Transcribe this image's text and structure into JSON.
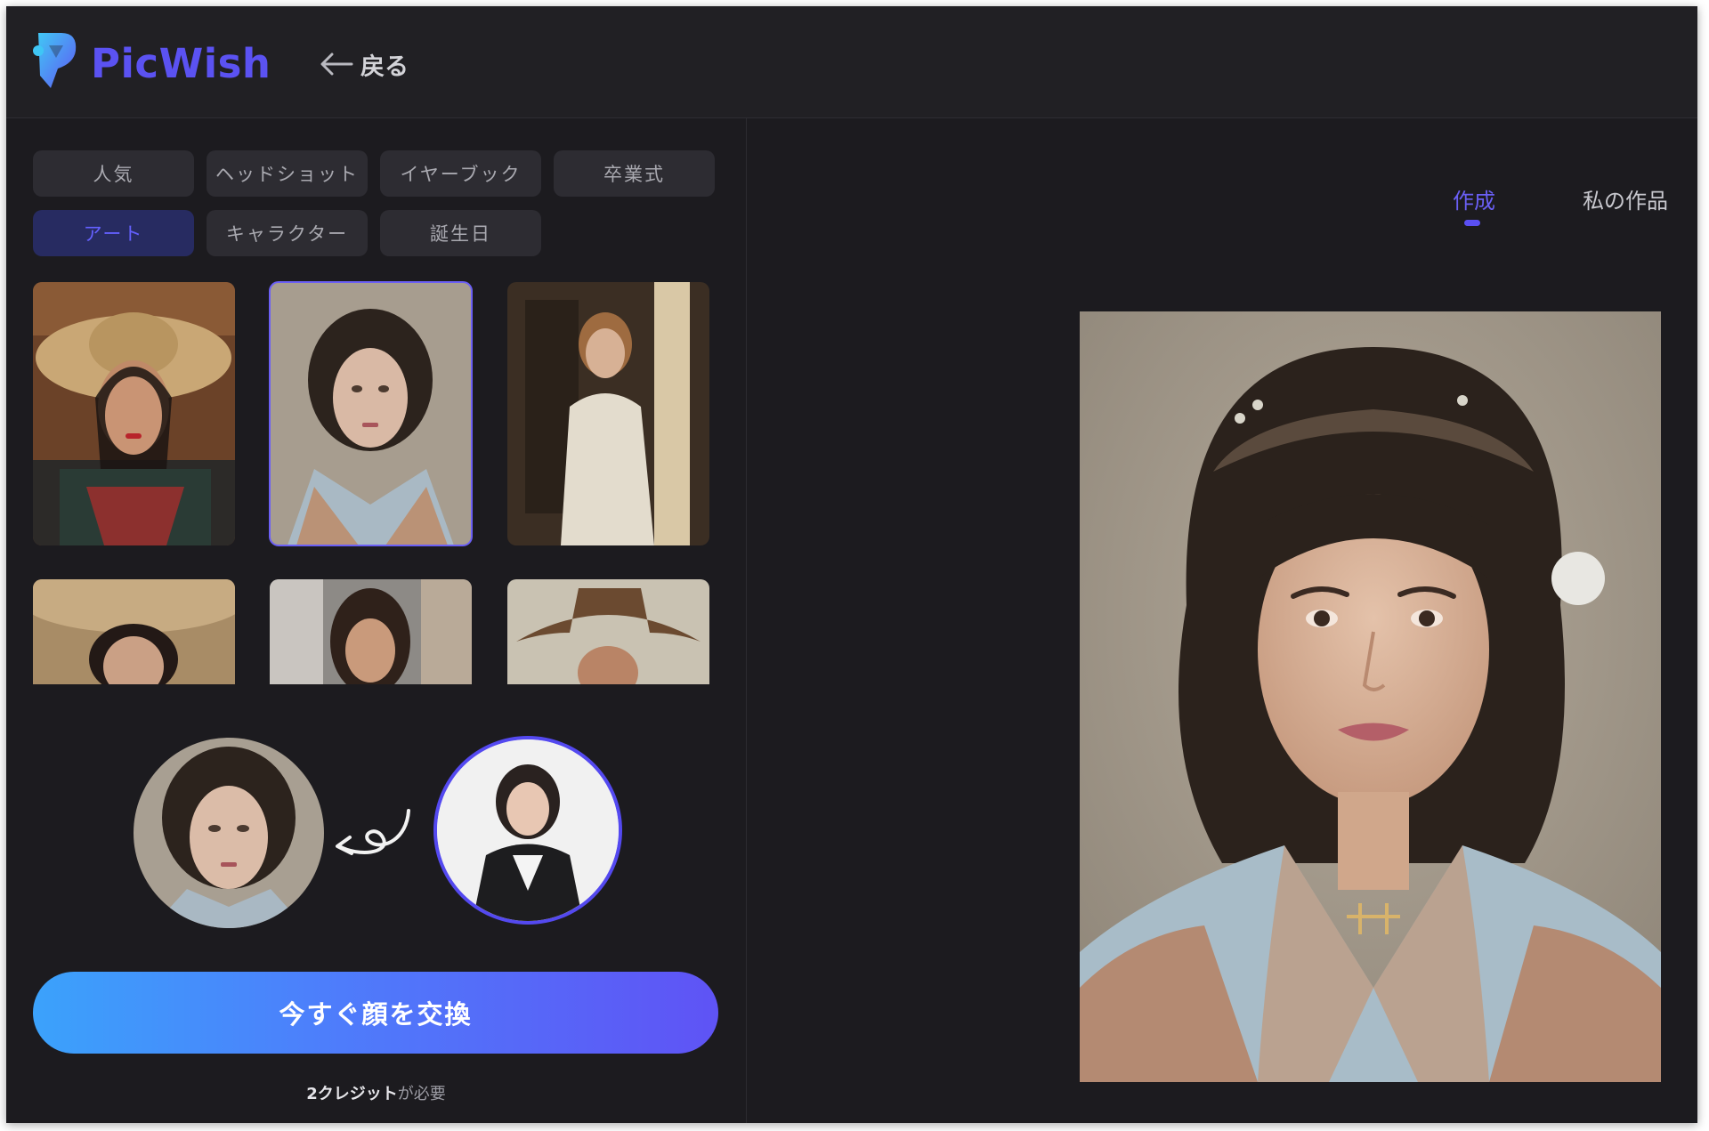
{
  "app": {
    "brand": "PicWish",
    "accent_color": "#5b52f2",
    "background_color": "#1c1b1f"
  },
  "header": {
    "back_label": "戻る",
    "back_icon": "arrow-left-icon"
  },
  "categories": [
    {
      "label": "人気",
      "active": false
    },
    {
      "label": "ヘッドショット",
      "active": false
    },
    {
      "label": "イヤーブック",
      "active": false
    },
    {
      "label": "卒業式",
      "active": false
    },
    {
      "label": "アート",
      "active": true
    },
    {
      "label": "キャラクター",
      "active": false
    },
    {
      "label": "誕生日",
      "active": false
    }
  ],
  "templates": [
    {
      "name": "sombrero-woman",
      "selected": false
    },
    {
      "name": "kimono-woman",
      "selected": true
    },
    {
      "name": "vintage-white-dress-woman",
      "selected": false
    },
    {
      "name": "straw-hat-woman",
      "selected": false
    },
    {
      "name": "long-hair-woman",
      "selected": false
    },
    {
      "name": "cowboy-man",
      "selected": false
    }
  ],
  "swap": {
    "source_icon": "template-face-thumbnail",
    "arrow_icon": "curly-arrow-left-icon",
    "target_icon": "uploaded-face-thumbnail"
  },
  "cta": {
    "label": "今すぐ顔を交換",
    "credits_strong": "2クレジット",
    "credits_rest": "が必要"
  },
  "result_tabs": [
    {
      "label": "作成",
      "active": true
    },
    {
      "label": "私の作品",
      "active": false
    }
  ]
}
